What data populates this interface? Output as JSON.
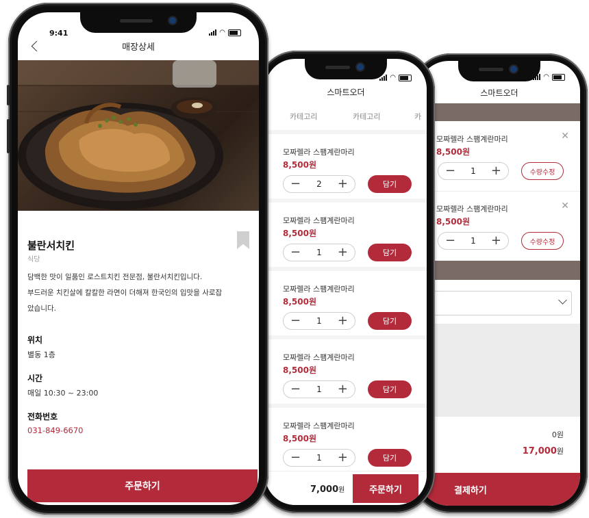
{
  "colors": {
    "accent": "#b32b3a",
    "header_band": "#7a6b67"
  },
  "phone1": {
    "time": "9:41",
    "title": "매장상세",
    "store_name": "불란서치킨",
    "category": "식당",
    "description_line1": "담백한 맛이 일품인 로스트치킨 전문점, 불란서치킨입니다.",
    "description_line2": "부드러운 치킨살에 칼칼한 라면이 더해져 한국인의 입맛을 사로잡",
    "description_line3": "았습니다.",
    "location_label": "위치",
    "location_value": "별동 1층",
    "hours_label": "시간",
    "hours_value": "매일 10:30 ~ 23:00",
    "phone_label": "전화번호",
    "phone_value": "031-849-6670",
    "order_button": "주문하기",
    "back_icon": "chevron-left-icon",
    "bookmark_icon": "bookmark-icon"
  },
  "phone2": {
    "title": "스마트오더",
    "tabs": [
      "카테고리",
      "카테고리",
      "카"
    ],
    "items": [
      {
        "name": "모짜렐라 스팸계란마리",
        "price": "8,500원",
        "qty": "2",
        "add_label": "담기"
      },
      {
        "name": "모짜렐라 스팸계란마리",
        "price": "8,500원",
        "qty": "1",
        "add_label": "담기"
      },
      {
        "name": "모짜렐라 스팸계란마리",
        "price": "8,500원",
        "qty": "1",
        "add_label": "담기"
      },
      {
        "name": "모짜렐라 스팸계란마리",
        "price": "8,500원",
        "qty": "1",
        "add_label": "담기"
      },
      {
        "name": "모짜렐라 스팸계란마리",
        "price": "8,500원",
        "qty": "1",
        "add_label": "담기"
      }
    ],
    "total": "7,000",
    "currency": "원",
    "order_button": "주문하기"
  },
  "phone3": {
    "title": "스마트오더",
    "cart": [
      {
        "name": "모짜렐라 스팸계란마리",
        "price": "8,500원",
        "qty": "1",
        "edit_label": "수량수정"
      },
      {
        "name": "모짜렐라 스팸계란마리",
        "price": "8,500원",
        "qty": "1",
        "edit_label": "수량수정"
      }
    ],
    "discount_value": "0원",
    "total_value": "17,000",
    "currency": "원",
    "pay_button": "결제하기"
  }
}
